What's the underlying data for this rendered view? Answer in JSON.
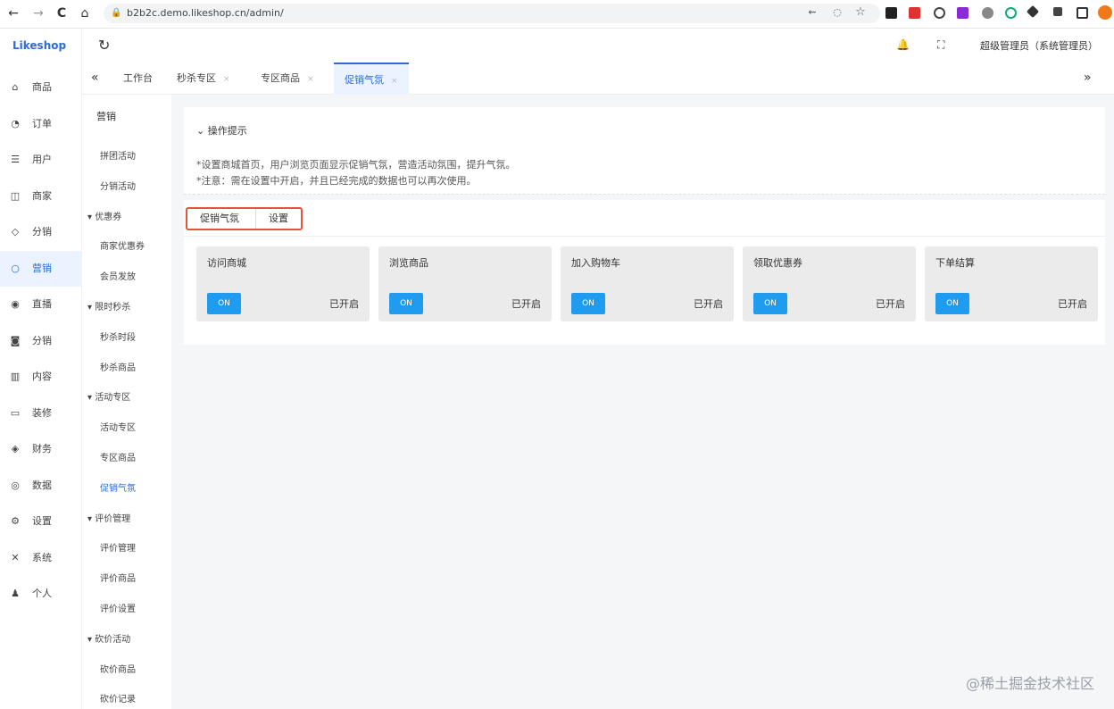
{
  "browser": {
    "url": "b2b2c.demo.likeshop.cn/admin/",
    "lock": "🔒",
    "back": "←",
    "forward": "→",
    "reload": "C",
    "home": "⌂",
    "icons": {
      "translate": "⇜",
      "user": "◌",
      "star": "☆"
    }
  },
  "app": {
    "logo": "Likeshop",
    "mainnav": [
      {
        "icon": "⌂",
        "label": "商品"
      },
      {
        "icon": "◔",
        "label": "订单"
      },
      {
        "icon": "☰",
        "label": "用户"
      },
      {
        "icon": "◫",
        "label": "商家"
      },
      {
        "icon": "◇",
        "label": "分销"
      },
      {
        "icon": "○",
        "label": "营销"
      },
      {
        "icon": "◉",
        "label": "直播"
      },
      {
        "icon": "◙",
        "label": "分销"
      },
      {
        "icon": "▥",
        "label": "内容"
      },
      {
        "icon": "▭",
        "label": "装修"
      },
      {
        "icon": "◈",
        "label": "财务"
      },
      {
        "icon": "◎",
        "label": "数据"
      },
      {
        "icon": "⚙",
        "label": "设置"
      },
      {
        "icon": "✕",
        "label": "系统"
      },
      {
        "icon": "♟",
        "label": "个人"
      }
    ],
    "active_nav_index": 5
  },
  "topbar": {
    "refresh": "↻",
    "bell": "🔔",
    "fullscreen": "⛶",
    "admin": "超级管理员（系统管理员）"
  },
  "tabs": {
    "collapse": "«",
    "expand": "»",
    "items": [
      {
        "label": "工作台"
      },
      {
        "label": "秒杀专区"
      },
      {
        "label": "专区商品"
      },
      {
        "label": "促销气氛"
      }
    ],
    "close": "×"
  },
  "subnav": {
    "head": "营销",
    "items": [
      {
        "label": "拼团活动",
        "kind": "leaf"
      },
      {
        "label": "分销活动",
        "kind": "leaf"
      },
      {
        "label": "优惠券",
        "kind": "group"
      },
      {
        "label": "商家优惠券",
        "kind": "leaf"
      },
      {
        "label": "会员发放",
        "kind": "leaf"
      },
      {
        "label": "限时秒杀",
        "kind": "group"
      },
      {
        "label": "秒杀时段",
        "kind": "leaf"
      },
      {
        "label": "秒杀商品",
        "kind": "leaf"
      },
      {
        "label": "活动专区",
        "kind": "group"
      },
      {
        "label": "活动专区",
        "kind": "leaf"
      },
      {
        "label": "专区商品",
        "kind": "leaf"
      },
      {
        "label": "促销气氛",
        "kind": "leaf",
        "active": true
      },
      {
        "label": "评价管理",
        "kind": "group"
      },
      {
        "label": "评价管理",
        "kind": "leaf"
      },
      {
        "label": "评价商品",
        "kind": "leaf"
      },
      {
        "label": "评价设置",
        "kind": "leaf"
      },
      {
        "label": "砍价活动",
        "kind": "group"
      },
      {
        "label": "砍价商品",
        "kind": "leaf"
      },
      {
        "label": "砍价记录",
        "kind": "leaf"
      }
    ]
  },
  "tips": {
    "title": "操作提示",
    "lines": [
      "*设置商城首页，用户浏览页面显示促销气氛，营造活动氛围，提升气氛。",
      "*注意：需在设置中开启，并且已经完成的数据也可以再次使用。"
    ]
  },
  "panel": {
    "tabs": [
      "促销气氛",
      "设置"
    ],
    "cards": [
      {
        "title": "访问商城",
        "switch": "ON",
        "status": "已开启"
      },
      {
        "title": "浏览商品",
        "switch": "ON",
        "status": "已开启"
      },
      {
        "title": "加入购物车",
        "switch": "ON",
        "status": "已开启"
      },
      {
        "title": "领取优惠券",
        "switch": "ON",
        "status": "已开启"
      },
      {
        "title": "下单结算",
        "switch": "ON",
        "status": "已开启"
      }
    ]
  },
  "watermark": "@稀土掘金技术社区",
  "colors": {
    "accent": "#2b6cd8",
    "switch": "#1f9bf0",
    "highlight": "#e5533a"
  }
}
